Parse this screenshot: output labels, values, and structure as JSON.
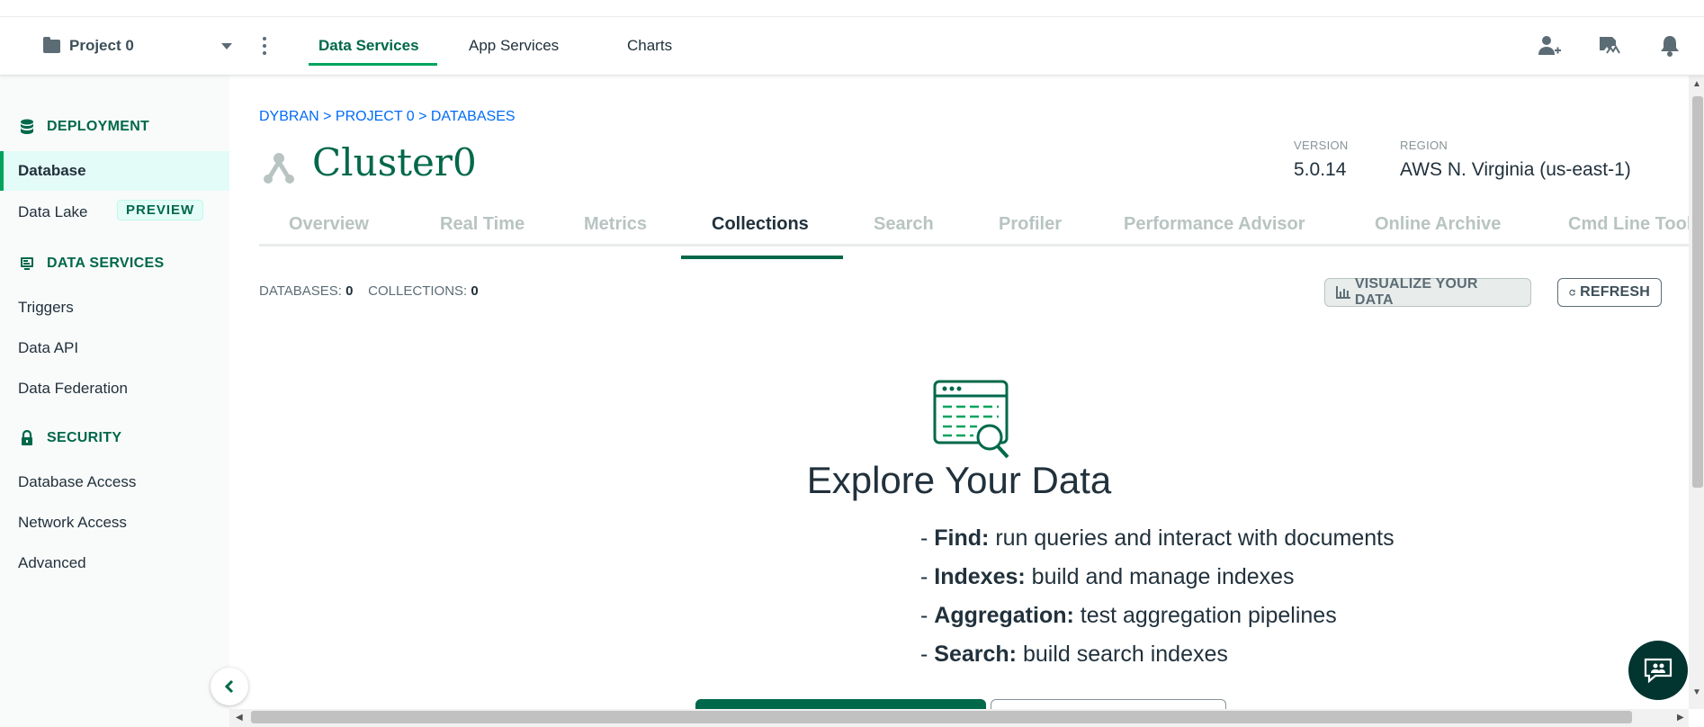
{
  "topbar": {
    "project": "Project 0",
    "tabs": [
      {
        "label": "Data Services"
      },
      {
        "label": "App Services"
      },
      {
        "label": "Charts"
      }
    ],
    "icons": [
      "invite-user-icon",
      "activity-feed-icon",
      "bell-icon"
    ]
  },
  "sidebar": {
    "deployment": {
      "title": "DEPLOYMENT",
      "items": [
        {
          "label": "Database"
        },
        {
          "label": "Data Lake"
        }
      ],
      "badge": "PREVIEW"
    },
    "data_services": {
      "title": "DATA SERVICES",
      "items": [
        {
          "label": "Triggers"
        },
        {
          "label": "Data API"
        },
        {
          "label": "Data Federation"
        }
      ]
    },
    "security": {
      "title": "SECURITY",
      "items": [
        {
          "label": "Database Access"
        },
        {
          "label": "Network Access"
        },
        {
          "label": "Advanced"
        }
      ]
    }
  },
  "main": {
    "breadcrumb": "DYBRAN > PROJECT 0 > DATABASES",
    "cluster_name": "Cluster0",
    "version_label": "VERSION",
    "version": "5.0.14",
    "region_label": "REGION",
    "region": "AWS N. Virginia (us-east-1)",
    "tabs": [
      {
        "label": "Overview"
      },
      {
        "label": "Real Time"
      },
      {
        "label": "Metrics"
      },
      {
        "label": "Collections"
      },
      {
        "label": "Search"
      },
      {
        "label": "Profiler"
      },
      {
        "label": "Performance Advisor"
      },
      {
        "label": "Online Archive"
      },
      {
        "label": "Cmd Line Tools"
      }
    ],
    "active_tab": "Collections",
    "databases_label": "DATABASES:",
    "databases_count": "0",
    "collections_label": "COLLECTIONS:",
    "collections_count": "0",
    "visualize_button": "VISUALIZE YOUR DATA",
    "refresh_button": "REFRESH",
    "explore_title": "Explore Your Data",
    "features": [
      {
        "name": "Find:",
        "desc": "run queries and interact with documents"
      },
      {
        "name": "Indexes:",
        "desc": "build and manage indexes"
      },
      {
        "name": "Aggregation:",
        "desc": "test aggregation pipelines"
      },
      {
        "name": "Search:",
        "desc": "build search indexes"
      }
    ]
  },
  "colors": {
    "brand_green": "#00684a",
    "accent_green": "#00a35c",
    "link_blue": "#016bf8"
  }
}
